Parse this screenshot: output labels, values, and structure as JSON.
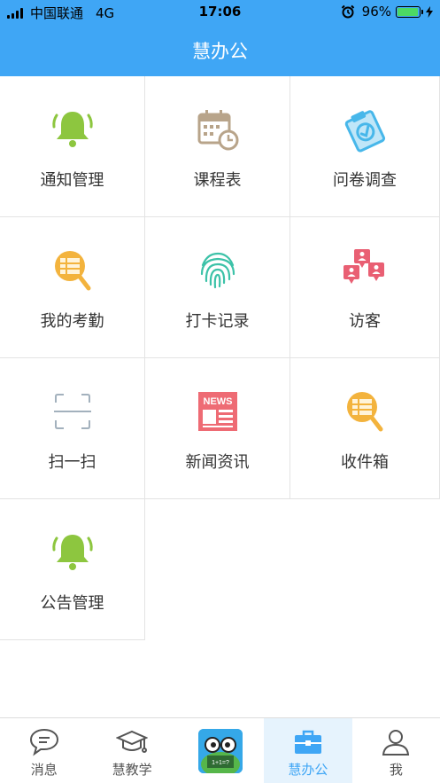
{
  "status_bar": {
    "carrier": "中国联通",
    "network": "4G",
    "time": "17:06",
    "battery": "96%",
    "battery_level": 0.96
  },
  "header": {
    "title": "慧办公"
  },
  "grid": [
    {
      "label": "通知管理",
      "icon": "bell-icon",
      "color": "#8dc63f"
    },
    {
      "label": "课程表",
      "icon": "calendar-clock-icon",
      "color": "#b8a48a"
    },
    {
      "label": "问卷调查",
      "icon": "clipboard-check-icon",
      "color": "#47b7ea"
    },
    {
      "label": "我的考勤",
      "icon": "attendance-search-icon",
      "color": "#f3b33d"
    },
    {
      "label": "打卡记录",
      "icon": "fingerprint-icon",
      "color": "#3cc2a8"
    },
    {
      "label": "访客",
      "icon": "visitor-icon",
      "color": "#e95f73"
    },
    {
      "label": "扫一扫",
      "icon": "scan-icon",
      "color": "#a3b1bd"
    },
    {
      "label": "新闻资讯",
      "icon": "news-icon",
      "color": "#ee6b74",
      "icon_text": "NEWS"
    },
    {
      "label": "收件箱",
      "icon": "inbox-search-icon",
      "color": "#f3b33d"
    },
    {
      "label": "公告管理",
      "icon": "bell-icon",
      "color": "#8dc63f"
    }
  ],
  "tabs": [
    {
      "label": "消息",
      "icon": "chat-icon"
    },
    {
      "label": "慧教学",
      "icon": "graduation-cap-icon"
    },
    {
      "label": "",
      "icon": "app-avatar-icon",
      "avatar_text": "1+1=?"
    },
    {
      "label": "慧办公",
      "icon": "briefcase-icon",
      "active": true
    },
    {
      "label": "我",
      "icon": "person-icon"
    }
  ],
  "colors": {
    "accent": "#3fa6f5"
  }
}
